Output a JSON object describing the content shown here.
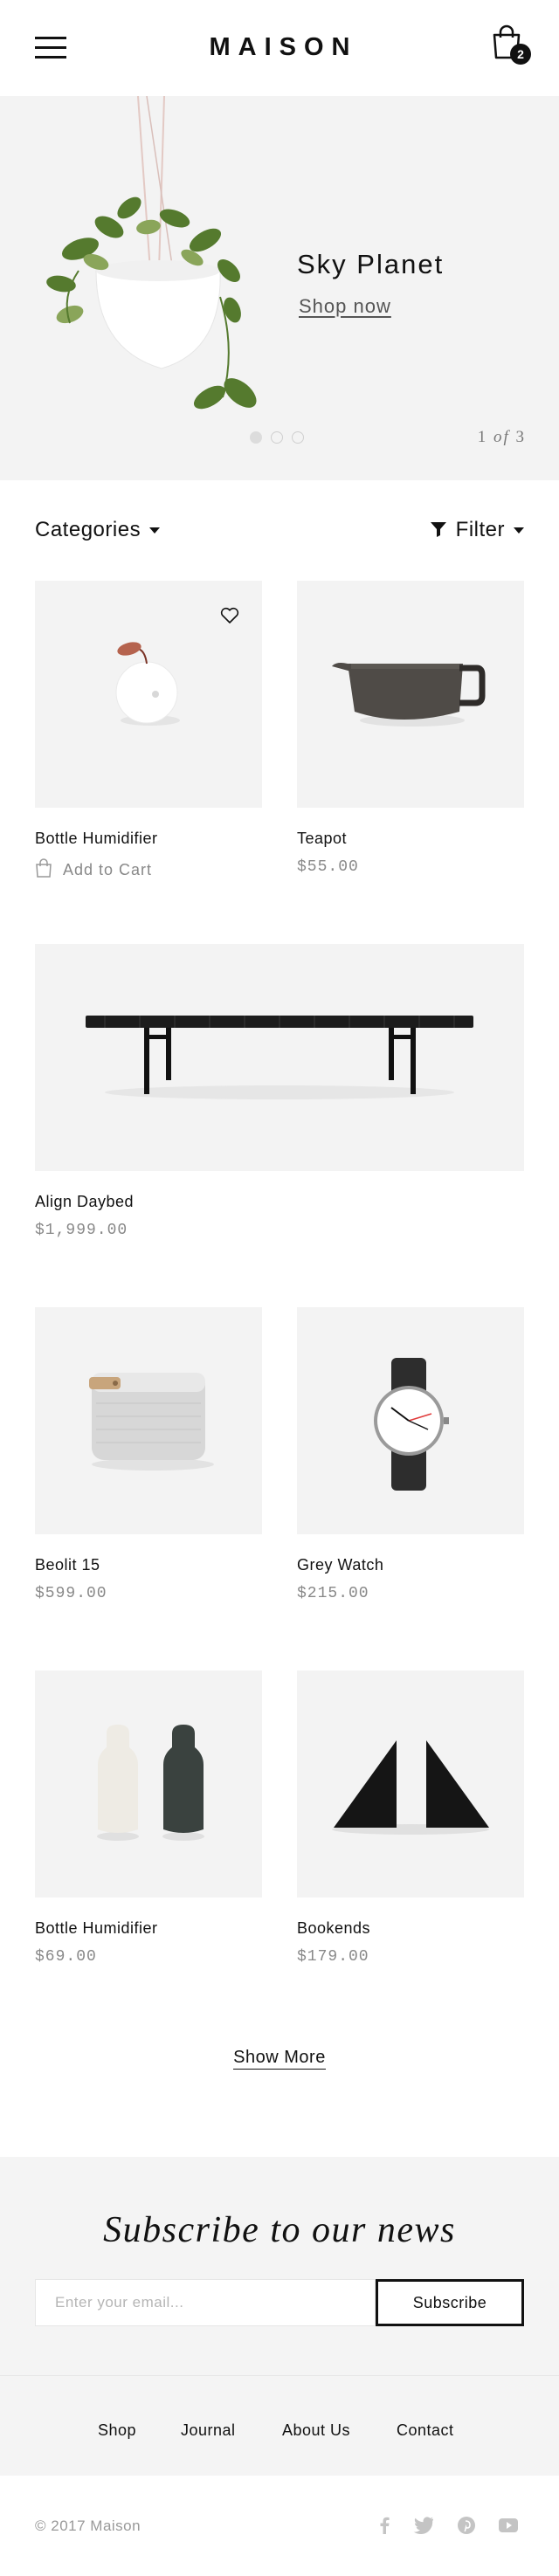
{
  "header": {
    "brand": "MAISON",
    "cart_count": "2"
  },
  "hero": {
    "title": "Sky Planet",
    "cta": "Shop now",
    "page_current": "1",
    "page_of": "of",
    "page_total": "3",
    "slides": 3,
    "active_slide": 1
  },
  "toolbar": {
    "categories_label": "Categories",
    "filter_label": "Filter"
  },
  "products": [
    {
      "name": "Bottle Humidifier",
      "action": "Add to Cart"
    },
    {
      "name": "Teapot",
      "price": "$55.00"
    },
    {
      "name": "Align Daybed",
      "price": "$1,999.00"
    },
    {
      "name": "Beolit 15",
      "price": "$599.00"
    },
    {
      "name": "Grey Watch",
      "price": "$215.00"
    },
    {
      "name": "Bottle Humidifier",
      "price": "$69.00"
    },
    {
      "name": "Bookends",
      "price": "$179.00"
    }
  ],
  "show_more": "Show More",
  "newsletter": {
    "title": "Subscribe to our news",
    "placeholder": "Enter your email...",
    "button": "Subscribe"
  },
  "footer_nav": [
    "Shop",
    "Journal",
    "About Us",
    "Contact"
  ],
  "copyright": "© 2017 Maison",
  "social_icons": [
    "facebook-icon",
    "twitter-icon",
    "pinterest-icon",
    "youtube-icon"
  ],
  "colors": {
    "text": "#1b1b1b",
    "muted": "#888888",
    "panel": "#f3f3f3",
    "accent": "#111111"
  }
}
